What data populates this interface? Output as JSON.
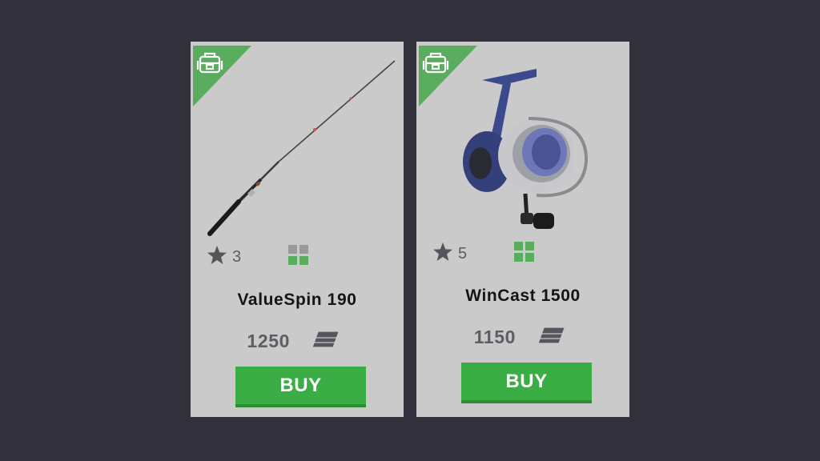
{
  "shop": {
    "items": [
      {
        "name": "ValueSpin 190",
        "rank": "3",
        "price": "1250",
        "buy_label": "BUY",
        "category_icon": "backpack-icon",
        "image": "spinning-rod",
        "slots": {
          "filled": [
            false,
            false,
            true,
            true
          ]
        }
      },
      {
        "name": "WinCast 1500",
        "rank": "5",
        "price": "1150",
        "buy_label": "BUY",
        "category_icon": "backpack-icon",
        "image": "spinning-reel",
        "slots": {
          "filled": [
            true,
            true,
            true,
            true
          ]
        }
      }
    ],
    "colors": {
      "background": "#33323c",
      "card": "#cacaca",
      "accent_green": "#3aae44",
      "corner_green": "#5aac5e"
    }
  }
}
